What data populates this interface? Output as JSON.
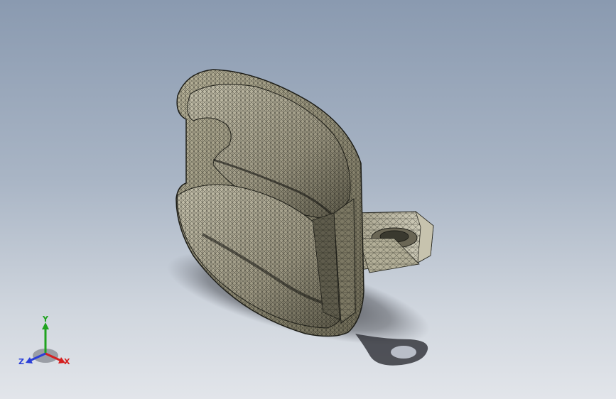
{
  "viewport": {
    "background_top": "#8a9ab0",
    "background_bottom": "#e2e5ea",
    "model_color": "#8f8a72",
    "mesh_color": "#1e1e18",
    "shadow_color": "#2a2b30"
  },
  "triad": {
    "x_label": "X",
    "y_label": "Y",
    "z_label": "Z",
    "x_color": "#d42020",
    "y_color": "#1fa31f",
    "z_color": "#2a3fd8"
  }
}
